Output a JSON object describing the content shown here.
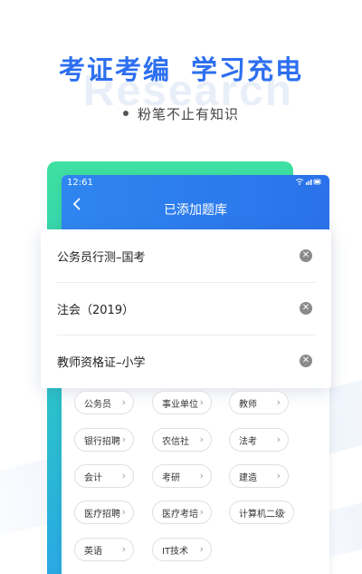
{
  "promo": {
    "headline_part1": "考证考编",
    "headline_part2": "学习充电",
    "watermark": "Research",
    "subline": "粉笔不止有知识"
  },
  "phone": {
    "status_time": "12:61",
    "status_icons": "wifi signal battery",
    "back_icon": "back-arrow-icon",
    "title": "已添加题库"
  },
  "added_banks": [
    {
      "label": "公务员行测–国考",
      "icon": "remove-icon"
    },
    {
      "label": "注会（2019）",
      "icon": "remove-icon"
    },
    {
      "label": "教师资格证–小学",
      "icon": "remove-icon"
    }
  ],
  "categories": [
    [
      "公务员",
      "事业单位",
      "教师"
    ],
    [
      "银行招聘",
      "农信社",
      "法考"
    ],
    [
      "会计",
      "考研",
      "建造"
    ],
    [
      "医疗招聘",
      "医疗考培",
      "计算机二级"
    ],
    [
      "英语",
      "IT技术"
    ]
  ],
  "colors": {
    "brand_blue": "#2d6ff0",
    "header_blue": "#2f86f0",
    "card_green": "#3fe0a0"
  }
}
